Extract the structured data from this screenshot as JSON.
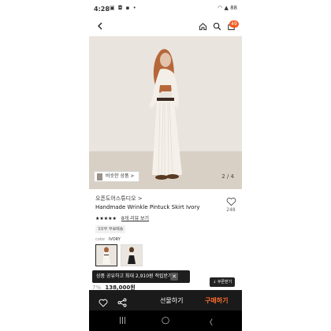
{
  "status_bar": {
    "time": "4:28",
    "left_icons": "▣ ◘ ▪ •",
    "right_icons": "◠ ▲ 88"
  },
  "nav": {
    "cart_count": "49"
  },
  "hero": {
    "similar_button": "비슷한 상품 >",
    "image_counter": "2 / 4"
  },
  "product": {
    "brand": "오픈도어스튜디오 >",
    "title": "Handmade Wrinkle Pintuck Skirt Ivory",
    "likes": "248",
    "rating_stars": "★★★★★",
    "review_link": "8개 리뷰 보기",
    "tag": "3코무 무료배송",
    "color_label": "color",
    "color_value": "IVORY"
  },
  "coupon": {
    "toast_text": "상품 공유하고 최대 2,910원 적립받기",
    "toast_close": "✕",
    "side_button": "↓ 쿠폰받기"
  },
  "price": {
    "discount": "7%",
    "value": "138,000원"
  },
  "action_bar": {
    "gift_label": "선물하기",
    "buy_label": "구매하기"
  },
  "system_nav": {
    "recents": "|||",
    "home": "◯",
    "back": "〈"
  },
  "colors": {
    "accent": "#ff6b2c",
    "badge": "#f25a1c",
    "action_bar_bg": "#1a1a1a"
  },
  "icons": [
    "back-arrow-icon",
    "home-icon",
    "search-icon",
    "cart-icon",
    "heart-icon",
    "share-icon"
  ]
}
